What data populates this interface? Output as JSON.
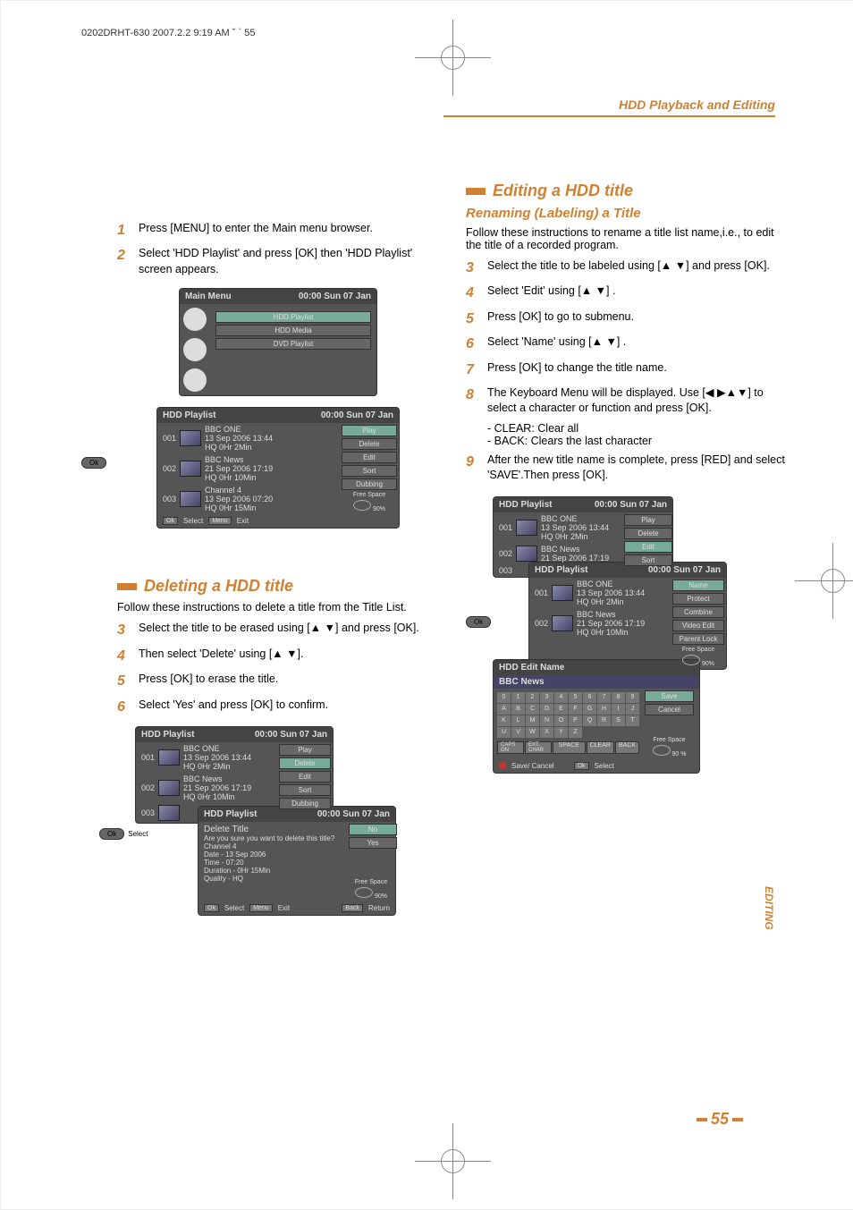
{
  "header_line": "0202DRHT-630  2007.2.2 9:19 AM  ˘ ` 55",
  "section_header": "HDD Playback and Editing",
  "left": {
    "step1": "Press [MENU] to enter the Main menu browser.",
    "step2": "Select 'HDD Playlist' and press [OK] then 'HDD Playlist' screen appears.",
    "del_title": "Deleting a HDD title",
    "del_intro": "Follow these instructions to delete a title from the Title List.",
    "step3": "Select the title to be erased using [▲ ▼] and press [OK].",
    "step4": "Then select 'Delete' using [▲ ▼].",
    "step5": "Press [OK] to erase the title.",
    "step6": "Select 'Yes'  and press [OK] to confirm."
  },
  "right": {
    "edit_title": "Editing a HDD title",
    "rename_title": "Renaming (Labeling) a Title",
    "intro": "Follow these instructions to rename a title list name,i.e., to edit the title of a recorded program.",
    "s3": "Select the title to be labeled using [▲ ▼] and press [OK].",
    "s4": "Select 'Edit' using [▲ ▼] .",
    "s5": "Press [OK] to go to submenu.",
    "s6": "Select 'Name' using [▲ ▼] .",
    "s7": "Press [OK] to change the title name.",
    "s8": "The Keyboard Menu will be displayed. Use [◀ ▶▲▼] to select a character or function and press [OK].",
    "s8a": "- CLEAR: Clear all",
    "s8b": "- BACK: Clears the last character",
    "s9": " After the new title name is complete, press [RED] and select 'SAVE'.Then press [OK]."
  },
  "osd": {
    "main_menu": "Main Menu",
    "clock": "00:00 Sun 07 Jan",
    "hdd_playlist": "HDD Playlist",
    "hdd_media": "HDD Media",
    "dvd_playlist": "DVD Playlist",
    "ok": "Ok",
    "select": "Select",
    "menu": "Menu",
    "exit": "Exit",
    "back": "Back",
    "return": "Return",
    "play": "Play",
    "delete": "Delete",
    "edit": "Edit",
    "sort": "Sort",
    "dubbing": "Dubbing",
    "free_space": "Free Space",
    "pct": "90%",
    "pct2": "90 %",
    "t1_n": "001",
    "t1_a": "BBC ONE",
    "t1_b": "13 Sep 2006 13:44",
    "t1_c": "HQ  0Hr  2Min",
    "t2_n": "002",
    "t2_a": "BBC News",
    "t2_b": "21 Sep 2006 17:19",
    "t2_c": "HQ  0Hr  10Min",
    "t3_n": "003",
    "t3_a": "Channel 4",
    "t3_b": "13 Sep 2006 07:20",
    "t3_c": "HQ  0Hr  15Min",
    "del_hdr": "Delete Title",
    "del_q": "Are you sure you want to delete this title?",
    "no": "No",
    "yes": "Yes",
    "d_ch": "Channel 4",
    "d_date": "Date - 13 Sep 2006",
    "d_time": "Time - 07:20",
    "d_dur": "Duration - 0Hr 15Min",
    "d_q": "Quality - HQ",
    "name": "Name",
    "protect": "Protect",
    "combine": "Combine",
    "videoedit": "Video Edit",
    "parentlock": "Parent Lock",
    "edit_name": "HDD Edit Name",
    "bbc_news": "BBC News",
    "save": "Save",
    "cancel": "Cancel",
    "save_cancel": "Save/ Cancel",
    "keys": [
      "0",
      "1",
      "2",
      "3",
      "4",
      "5",
      "6",
      "7",
      "8",
      "9",
      "A",
      "B",
      "C",
      "D",
      "E",
      "F",
      "G",
      "H",
      "I",
      "J",
      "K",
      "L",
      "M",
      "N",
      "O",
      "P",
      "Q",
      "R",
      "S",
      "T",
      "U",
      "V",
      "W",
      "X",
      "Y",
      "Z"
    ],
    "caps": "CAPS\nON",
    "caps2": "EXT.\nCHAR",
    "space": "SPACE",
    "clear": "CLEAR",
    "backk": "BACK"
  },
  "vtab": "EDITING",
  "page_num": "55"
}
